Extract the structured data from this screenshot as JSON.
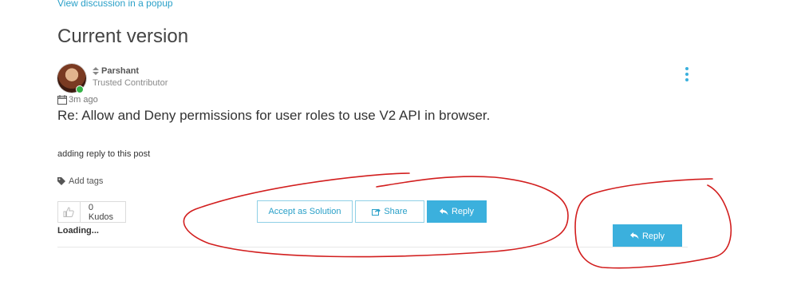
{
  "top_link": "View discussion in a popup",
  "page_title": "Current version",
  "post": {
    "author": "Parshant",
    "rank": "Trusted Contributor",
    "time": "3m ago",
    "subject": "Re: Allow and Deny permissions for user roles to use V2 API in browser.",
    "body": "adding reply to this post",
    "tags_label": "Add tags",
    "kudos_label": "0 Kudos",
    "actions": {
      "accept": "Accept as Solution",
      "share": "Share",
      "reply": "Reply"
    },
    "loading": "Loading...",
    "reply_secondary": "Reply"
  },
  "colors": {
    "accent": "#3bb0dd",
    "link": "#2aa0c8",
    "annotation": "#d21e1e",
    "online": "#35b347"
  },
  "icons": [
    "rank-icon",
    "calendar-icon",
    "tag-icon",
    "thumbs-up-icon",
    "share-icon",
    "reply-icon",
    "kebab-menu-icon"
  ]
}
